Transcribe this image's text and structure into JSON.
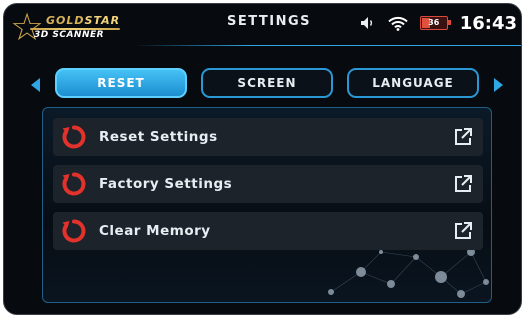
{
  "header": {
    "logo_line1_a": "GOLD",
    "logo_line1_b": "STAR",
    "logo_line2": "3D SCANNER",
    "title": "SETTINGS",
    "battery_percent": "36",
    "battery_level": 0.36,
    "time": "16:43"
  },
  "tabs": [
    {
      "label": "RESET",
      "active": true
    },
    {
      "label": "SCREEN",
      "active": false
    },
    {
      "label": "LANGUAGE",
      "active": false
    }
  ],
  "items": [
    {
      "label": "Reset Settings",
      "icon": "reset-icon",
      "action_icon": "open-external-icon"
    },
    {
      "label": "Factory Settings",
      "icon": "reset-icon",
      "action_icon": "open-external-icon"
    },
    {
      "label": "Clear Memory",
      "icon": "reset-icon",
      "action_icon": "open-external-icon"
    }
  ],
  "colors": {
    "accent": "#2fa6e6",
    "active_tab": "#2ba6e6",
    "icon_red": "#e2322b",
    "background": "#070b10"
  }
}
